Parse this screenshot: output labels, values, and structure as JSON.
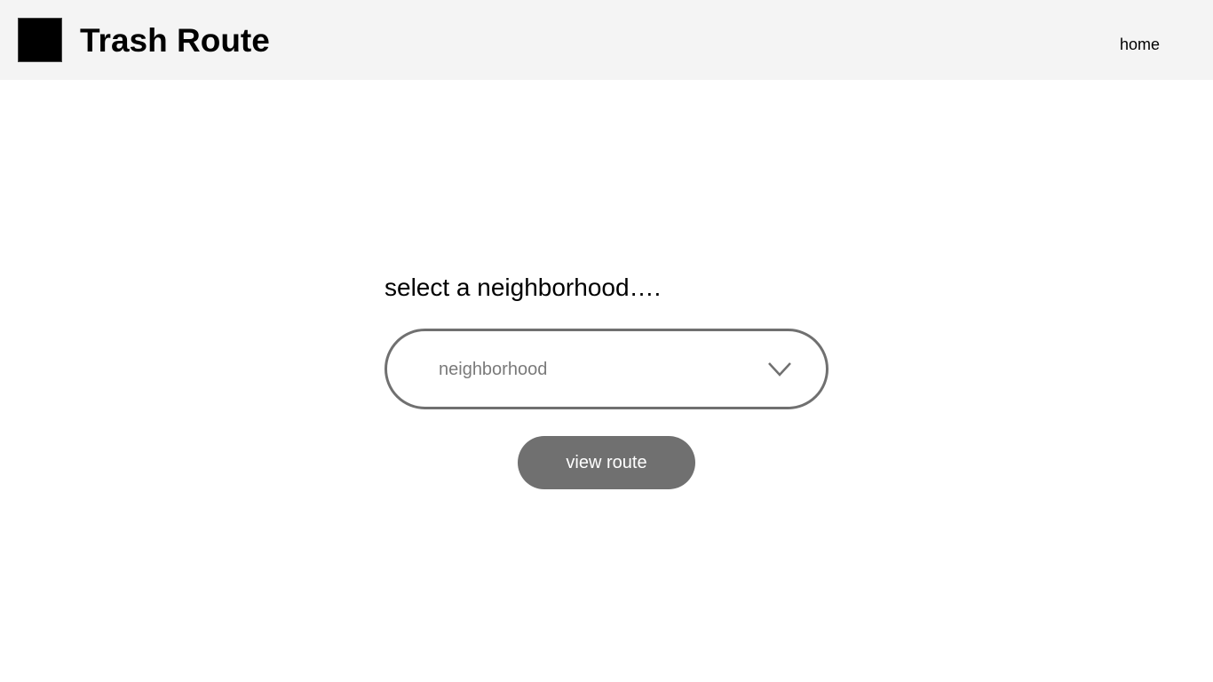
{
  "header": {
    "app_title": "Trash Route",
    "nav": {
      "home_label": "home"
    }
  },
  "main": {
    "prompt": "select a neighborhood….",
    "neighborhood_select": {
      "selected_value": "neighborhood",
      "icon": "chevron-down-icon"
    },
    "view_route_label": "view route"
  },
  "colors": {
    "header_bg": "#f4f4f4",
    "button_bg": "#707070",
    "select_border": "#707070",
    "placeholder_text": "#7a7a7a"
  }
}
